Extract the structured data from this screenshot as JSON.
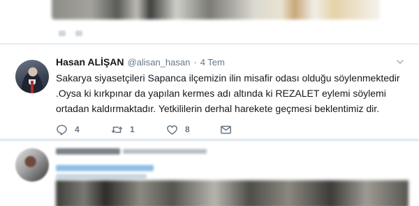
{
  "tweet": {
    "author_name": "Hasan ALİŞAN",
    "handle": "@alisan_hasan",
    "separator": "·",
    "time": "4 Tem",
    "text_lines": [
      "Sakarya siyasetçileri Sapanca ilçemizin ilin misafir odası olduğu söylenmektedir",
      ".Oysa ki kırkpınar da yapılan kermes adı altında ki REZALET eylemi söylemi",
      "ortadan kaldırmaktadır. Yetkililerin derhal harekete geçmesi beklentimiz dir."
    ],
    "actions": {
      "reply_count": "4",
      "retweet_count": "1",
      "like_count": "8"
    },
    "icons": {
      "reply": "reply-icon",
      "retweet": "retweet-icon",
      "like": "heart-icon",
      "message": "mail-icon",
      "more": "chevron-down-icon"
    }
  },
  "colors": {
    "text": "#14171a",
    "secondary": "#657786",
    "background": "#e6ecf0",
    "card": "#ffffff"
  }
}
